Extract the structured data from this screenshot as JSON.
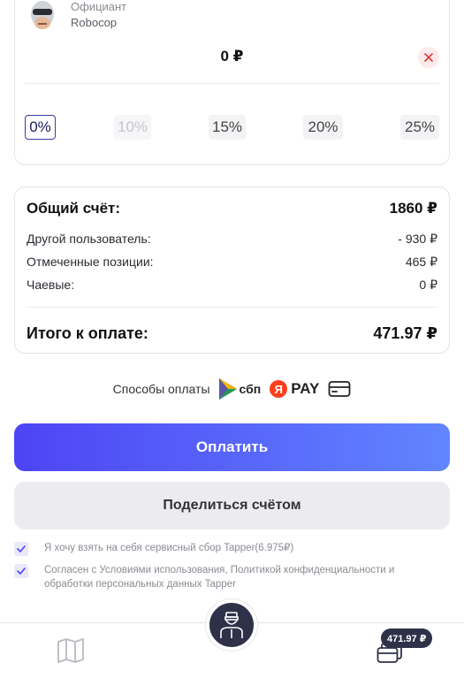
{
  "waiter": {
    "role": "Официант",
    "name": "Robocop"
  },
  "tips": {
    "amount": "0 ₽",
    "options": [
      {
        "label": "0%",
        "state": "selected"
      },
      {
        "label": "10%",
        "state": "disabled"
      },
      {
        "label": "15%",
        "state": "normal"
      },
      {
        "label": "20%",
        "state": "normal"
      },
      {
        "label": "25%",
        "state": "normal"
      }
    ]
  },
  "summary": {
    "total_bill_label": "Общий счёт:",
    "total_bill_value": "1860 ₽",
    "rows": [
      {
        "label": "Другой пользователь:",
        "value": "- 930 ₽"
      },
      {
        "label": "Отмеченные позиции:",
        "value": "465 ₽"
      },
      {
        "label": "Чаевые:",
        "value": "0 ₽"
      }
    ],
    "to_pay_label": "Итого к оплате:",
    "to_pay_value": "471.97 ₽"
  },
  "payment_methods": {
    "label": "Способы оплаты",
    "sbp": "сбп",
    "yandex_letter": "Я",
    "yandex_pay": "PAY",
    "icons": [
      "sbp-icon",
      "yandex-pay-icon",
      "card-icon"
    ]
  },
  "buttons": {
    "pay": "Оплатить",
    "share": "Поделиться счётом"
  },
  "checkboxes": [
    {
      "text": "Я хочу взять на себя сервисный сбор Tapper(6.975₽)",
      "checked": true
    },
    {
      "text": "Согласен с Условиями использования, Политикой конфиденциальности и обработки персональных данных Tapper",
      "checked": true
    }
  ],
  "bottom_nav": {
    "cart_badge": "471.97 ₽",
    "icons": [
      "menu-book-icon",
      "waiter-avatar-icon",
      "cart-cards-icon"
    ]
  },
  "colors": {
    "accent": "#4d44f5",
    "accent_end": "#6185ff",
    "dark": "#2e3148",
    "danger": "#e53935"
  }
}
